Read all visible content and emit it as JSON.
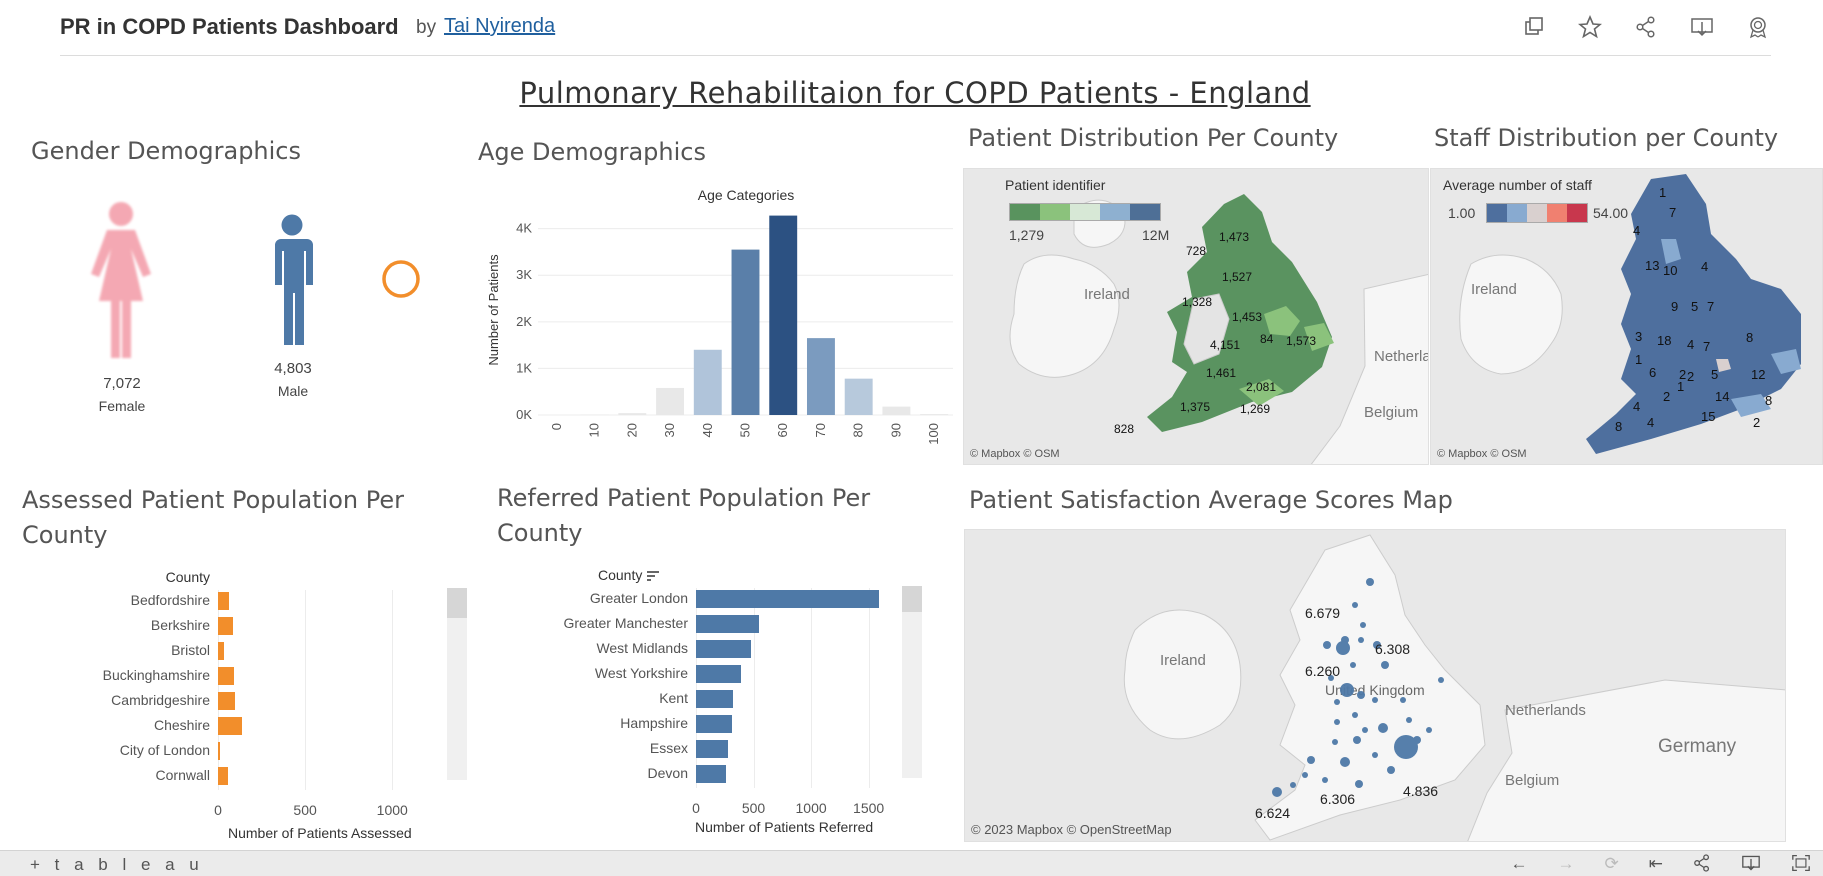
{
  "header": {
    "title": "PR in COPD Patients Dashboard",
    "by": "by",
    "author": "Tai Nyirenda",
    "icons": [
      "duplicate-icon",
      "favorite-star-icon",
      "share-icon",
      "download-icon",
      "badge-icon"
    ]
  },
  "main_title": "Pulmonary Rehabilitaion for COPD Patients - England",
  "gender": {
    "title": "Gender Demographics",
    "female": {
      "value": "7,072",
      "label": "Female",
      "color": "#f39aa6"
    },
    "male": {
      "value": "4,803",
      "label": "Male",
      "color": "#4e79a7"
    },
    "other_color": "#f28e2b"
  },
  "age": {
    "section_title": "Age Demographics",
    "chart_title": "Age Categories",
    "ylabel": "Number of Patients"
  },
  "patient_map": {
    "title": "Patient Distribution Per County",
    "legend_title": "Patient identifier",
    "legend_min": "1,279",
    "legend_max": "12M",
    "colors": [
      "#59935e",
      "#8bc27c",
      "#d7e8d6",
      "#8eb0d0",
      "#4e6f96"
    ],
    "labels": [
      "1,473",
      "728",
      "1,527",
      "1,328",
      "1,453",
      "4,151",
      "1,573",
      "1,461",
      "2,081",
      "1,375",
      "1,269",
      "828",
      "84"
    ],
    "place_labels": [
      "Ireland",
      "Netherla",
      "Belgium"
    ],
    "credit": "© Mapbox  © OSM"
  },
  "staff_map": {
    "title": "Staff Distribution per County",
    "legend_title": "Average number of staff",
    "legend_min": "1.00",
    "legend_max": "54.00",
    "colors": [
      "#4e6f9e",
      "#88aad0",
      "#d9d0cf",
      "#f08070",
      "#c8374d"
    ],
    "labels": [
      "1",
      "7",
      "4",
      "13",
      "10",
      "4",
      "9",
      "5",
      "7",
      "3",
      "18",
      "4",
      "7",
      "8",
      "1",
      "6",
      "2",
      "2",
      "5",
      "12",
      "14",
      "1",
      "2",
      "8",
      "4",
      "15",
      "4",
      "2",
      "8"
    ],
    "place_labels": [
      "Ireland"
    ],
    "credit": "© Mapbox  © OSM"
  },
  "assessed": {
    "title": "Assessed Patient Population Per County",
    "county_header": "County",
    "axis_title": "Number of Patients Assessed",
    "ticks": [
      "0",
      "500",
      "1000"
    ],
    "color": "#f28e2b"
  },
  "referred": {
    "title": "Referred Patient Population Per County",
    "county_header": "County",
    "axis_title": "Number of Patients Referred",
    "ticks": [
      "0",
      "500",
      "1000",
      "1500"
    ],
    "color": "#4e79a7"
  },
  "satisfaction": {
    "title": "Patient Satisfaction Average Scores Map",
    "labels": [
      "6.679",
      "6.308",
      "6.260",
      "6.306",
      "4.836",
      "6.624"
    ],
    "place_labels": [
      "Ireland",
      "Netherlands",
      "Germany",
      "Belgium",
      "United Kingdom"
    ],
    "credit": "© 2023 Mapbox  © OpenStreetMap"
  },
  "footer": {
    "brand": "+ t a b l e a u",
    "nav": [
      "←",
      "→",
      "⟳",
      "⇤",
      "share",
      "download",
      "fullscreen"
    ]
  },
  "chart_data": [
    {
      "type": "bar",
      "title": "Age Categories",
      "xlabel": "",
      "ylabel": "Number of Patients",
      "categories": [
        "0",
        "10",
        "20",
        "30",
        "40",
        "50",
        "60",
        "70",
        "80",
        "90",
        "100"
      ],
      "values": [
        0,
        10,
        40,
        580,
        1400,
        3550,
        4280,
        1650,
        780,
        180,
        20
      ],
      "colors": [
        "#e8e8e8",
        "#e8e8e8",
        "#e8e8e8",
        "#e8e8e8",
        "#b0c4da",
        "#5a7fa9",
        "#2c5182",
        "#7b9bbf",
        "#b7c9dc",
        "#e8e8e8",
        "#e8e8e8"
      ],
      "yticks": [
        "0K",
        "1K",
        "2K",
        "3K",
        "4K"
      ],
      "ylim": [
        0,
        4400
      ]
    },
    {
      "type": "bar",
      "orientation": "horizontal",
      "title": "Assessed Patient Population Per County",
      "xlabel": "Number of Patients Assessed",
      "categories": [
        "Bedfordshire",
        "Berkshire",
        "Bristol",
        "Buckinghamshire",
        "Cambridgeshire",
        "Cheshire",
        "City of London",
        "Cornwall"
      ],
      "values": [
        65,
        85,
        35,
        90,
        95,
        135,
        5,
        55
      ],
      "xlim": [
        0,
        1320
      ]
    },
    {
      "type": "bar",
      "orientation": "horizontal",
      "title": "Referred Patient Population Per County",
      "xlabel": "Number of Patients Referred",
      "categories": [
        "Greater London",
        "Greater Manchester",
        "West Midlands",
        "West Yorkshire",
        "Kent",
        "Hampshire",
        "Essex",
        "Devon"
      ],
      "values": [
        1590,
        545,
        480,
        395,
        320,
        310,
        275,
        260
      ],
      "xlim": [
        0,
        1790
      ]
    }
  ]
}
